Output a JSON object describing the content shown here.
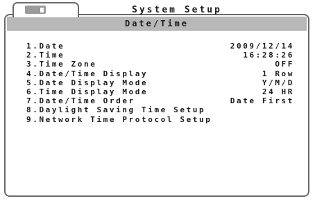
{
  "window": {
    "title": "System Setup",
    "icon": "memory-card-icon"
  },
  "panel": {
    "header": "Date/Time"
  },
  "menu": [
    {
      "label": "1.Date",
      "value": "2009/12/14"
    },
    {
      "label": "2.Time",
      "value": "16:28:26"
    },
    {
      "label": "3.Time Zone",
      "value": "OFF"
    },
    {
      "label": "4.Date/Time Display",
      "value": "1 Row"
    },
    {
      "label": "5.Date Display Mode",
      "value": "Y/M/D"
    },
    {
      "label": "6.Time Display Mode",
      "value": "24 HR"
    },
    {
      "label": "7.Date/Time Order",
      "value": "Date First"
    },
    {
      "label": "8.Daylight Saving Time Setup",
      "value": ""
    },
    {
      "label": "9.Network Time Protocol Setup",
      "value": ""
    }
  ],
  "colors": {
    "header_bar": "#b8b8b8",
    "frame_border": "#6a6a6a",
    "text": "#1a1a1a"
  }
}
